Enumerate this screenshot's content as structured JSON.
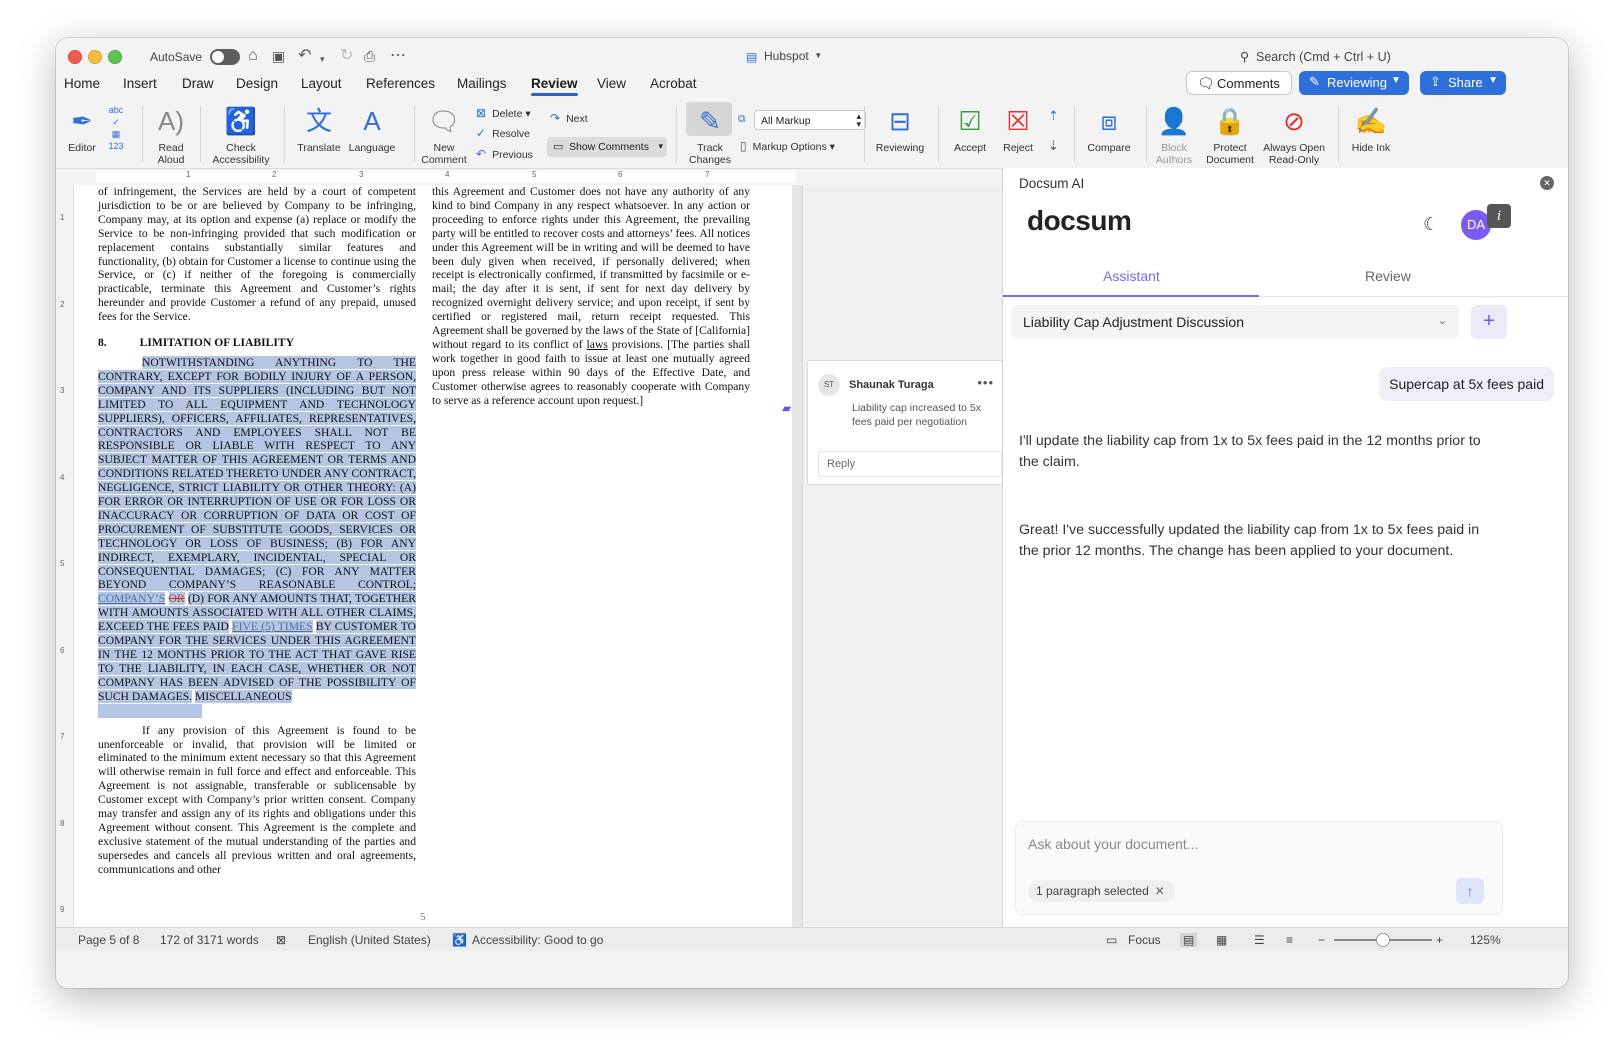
{
  "titlebar": {
    "autosave_label": "AutoSave",
    "doc_name": "Hubspot",
    "search_placeholder": "Search (Cmd + Ctrl + U)"
  },
  "tabs": [
    "Home",
    "Insert",
    "Draw",
    "Design",
    "Layout",
    "References",
    "Mailings",
    "Review",
    "View",
    "Acrobat"
  ],
  "active_tab": "Review",
  "right_buttons": {
    "comments": "Comments",
    "reviewing": "Reviewing",
    "share": "Share"
  },
  "ribbon": {
    "editor": "Editor",
    "read_aloud_1": "Read",
    "read_aloud_2": "Aloud",
    "check_access_1": "Check",
    "check_access_2": "Accessibility",
    "translate": "Translate",
    "language": "Language",
    "new_comment_1": "New",
    "new_comment_2": "Comment",
    "delete": "Delete",
    "resolve": "Resolve",
    "previous": "Previous",
    "next": "Next",
    "show_comments": "Show Comments",
    "track_changes_1": "Track",
    "track_changes_2": "Changes",
    "all_markup": "All Markup",
    "markup_options": "Markup Options",
    "reviewing": "Reviewing",
    "accept": "Accept",
    "reject": "Reject",
    "compare": "Compare",
    "block_authors_1": "Block",
    "block_authors_2": "Authors",
    "protect_doc_1": "Protect",
    "protect_doc_2": "Document",
    "always_open_1": "Always Open",
    "always_open_2": "Read-Only",
    "hide_ink": "Hide Ink"
  },
  "ruler_numbers": [
    "1",
    "2",
    "3",
    "4",
    "5",
    "6",
    "7"
  ],
  "vruler_numbers": [
    "1",
    "2",
    "3",
    "4",
    "5",
    "6",
    "7",
    "8",
    "9"
  ],
  "document": {
    "col1_top": "of infringement, the Services are held by a court of competent jurisdiction to be or are believed by Company to be infringing, Company may, at its option and expense (a) replace or modify the Service to be non-infringing provided that such modification or replacement contains substantially similar features and functionality, (b) obtain for Customer a license to continue using the Service, or (c) if neither of the foregoing is commercially practicable, terminate this Agreement and Customer’s rights hereunder and provide Customer a refund of any prepaid, unused fees for the Service.",
    "heading_num": "8.",
    "heading_text": "LIMITATION OF LIABILITY",
    "liability_a": "NOTWITHSTANDING ANYTHING TO THE CONTRARY, EXCEPT FOR BODILY INJURY OF A PERSON, COMPANY AND ITS SUPPLIERS (INCLUDING BUT NOT LIMITED TO ALL EQUIPMENT AND TECHNOLOGY SUPPLIERS), OFFICERS, AFFILIATES, REPRESENTATIVES, CONTRACTORS AND EMPLOYEES SHALL NOT BE RESPONSIBLE OR LIABLE WITH RESPECT TO ANY SUBJECT MATTER OF THIS AGREEMENT OR TERMS AND CONDITIONS RELATED THERETO UNDER ANY CONTRACT, NEGLIGENCE, STRICT LIABILITY OR OTHER THEORY: (A) FOR ERROR OR INTERRUPTION OF USE OR FOR LOSS OR INACCURACY OR CORRUPTION OF DATA OR COST OF PROCUREMENT OF SUBSTITUTE GOODS, SERVICES OR TECHNOLOGY OR LOSS OF BUSINESS; (B) FOR ANY INDIRECT, EXEMPLARY, INCIDENTAL, SPECIAL OR CONSEQUENTIAL DAMAGES; (C) FOR ANY MATTER BEYOND COMPANY’S REASONABLE CONTROL;",
    "ins_companys": "COMPANY’S",
    "del_or": "OR",
    "liability_b": "(D) FOR ANY AMOUNTS THAT, TOGETHER WITH AMOUNTS ASSOCIATED WITH ALL OTHER CLAIMS, EXCEED THE FEES PAID",
    "ins_five": "FIVE (5) TIMES",
    "liability_c": "BY CUSTOMER TO COMPANY FOR THE SERVICES UNDER THIS AGREEMENT IN THE 12 MONTHS PRIOR TO THE ACT THAT GAVE RISE TO THE LIABILITY, IN EACH CASE, WHETHER OR NOT COMPANY HAS BEEN ADVISED OF THE POSSIBILITY OF SUCH DAMAGES.",
    "misc": "MISCELLANEOUS",
    "col1_bottom": "If any provision of this Agreement is found to be unenforceable or invalid, that provision will be limited or eliminated to the minimum extent necessary so that this Agreement will otherwise remain in full force and effect and enforceable. This Agreement is not assignable, transferable or sublicensable by Customer except with Company’s prior written consent. Company may transfer and assign any of its rights and obligations under this Agreement without consent. This Agreement is the complete and exclusive statement of the mutual understanding of the parties and supersedes and cancels all previous written and oral agreements, communications and other",
    "col2_a": "this Agreement and Customer does not have any authority of any kind to bind Company in any respect whatsoever. In any action or proceeding to enforce rights under this Agreement, the prevailing party will be entitled to recover costs and attorneys’ fees. All notices under this Agreement will be in writing and will be deemed to have been duly given when received, if personally delivered; when receipt is electronically confirmed, if transmitted by facsimile or e-mail; the day after it is sent, if sent for next day delivery by recognized overnight delivery service; and upon receipt, if sent by certified or registered mail, return receipt requested. This Agreement shall be governed by the laws of the State of [California] without regard to its conflict of",
    "col2_laws": "laws",
    "col2_b": "provisions. [The parties shall work together in good faith to issue at least one mutually agreed upon press release within 90 days of the Effective Date, and Customer otherwise agrees to reasonably cooperate with Company to serve as a reference account upon request.]",
    "page_number": "5"
  },
  "comment": {
    "initials": "ST",
    "author": "Shaunak Turaga",
    "text": "Liability cap increased to 5x fees paid per negotiation",
    "reply_placeholder": "Reply"
  },
  "panel": {
    "title": "Docsum AI",
    "logo": "docsum",
    "avatar": "DA",
    "info": "i",
    "tab_assistant": "Assistant",
    "tab_review": "Review",
    "thread_select": "Liability Cap Adjustment Discussion",
    "user_msg": "Supercap at 5x fees paid",
    "bot_msg_1": "I'll update the liability cap from 1x to 5x fees paid in the 12 months prior to the claim.",
    "bot_msg_2": "Great! I've successfully updated the liability cap from 1x to 5x fees paid in the prior 12 months. The change has been applied to your document.",
    "input_placeholder": "Ask about your document...",
    "chip": "1 paragraph selected"
  },
  "status": {
    "page": "Page 5 of 8",
    "words": "172 of 3171 words",
    "language": "English (United States)",
    "accessibility": "Accessibility: Good to go",
    "focus": "Focus",
    "zoom": "125%"
  },
  "zoom_level": 1.25,
  "colors": {
    "accent": "#2f6fd9",
    "panel_accent": "#7a6ae6",
    "highlight": "#b4c6e4"
  }
}
